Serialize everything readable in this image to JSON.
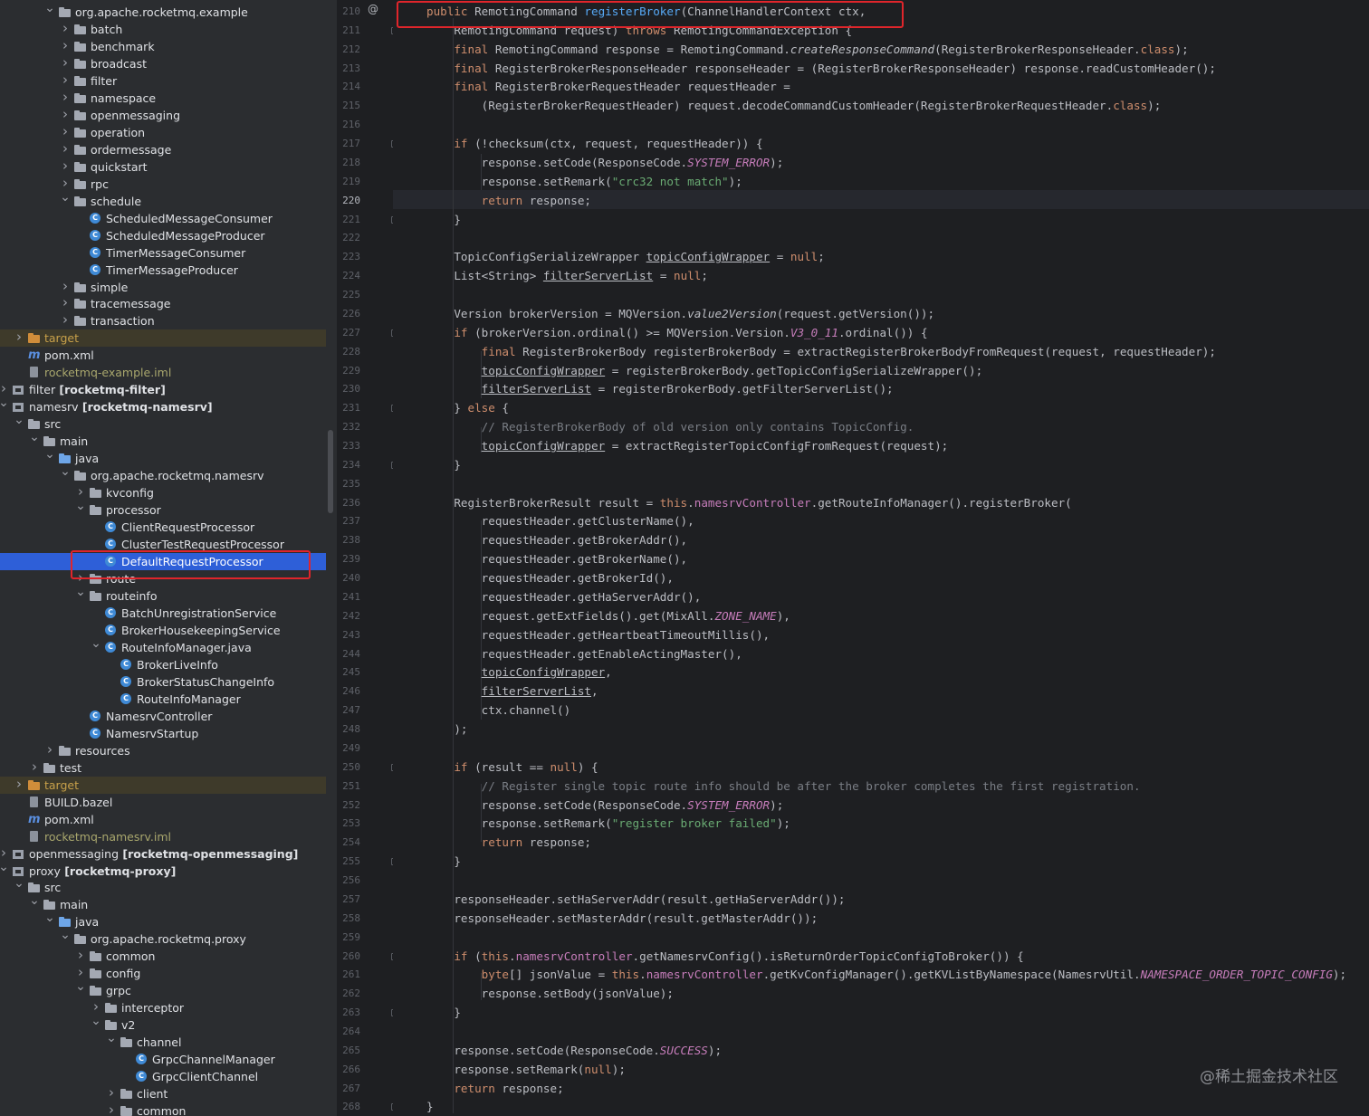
{
  "tree": {
    "rows": [
      {
        "label": "org.apache.rocketmq.example",
        "type": "package",
        "expanded": true
      },
      {
        "label": "batch",
        "type": "package"
      },
      {
        "label": "benchmark",
        "type": "package"
      },
      {
        "label": "broadcast",
        "type": "package"
      },
      {
        "label": "filter",
        "type": "package"
      },
      {
        "label": "namespace",
        "type": "package"
      },
      {
        "label": "openmessaging",
        "type": "package"
      },
      {
        "label": "operation",
        "type": "package"
      },
      {
        "label": "ordermessage",
        "type": "package"
      },
      {
        "label": "quickstart",
        "type": "package"
      },
      {
        "label": "rpc",
        "type": "package"
      },
      {
        "label": "schedule",
        "type": "package",
        "expanded": true
      },
      {
        "label": "ScheduledMessageConsumer",
        "type": "class"
      },
      {
        "label": "ScheduledMessageProducer",
        "type": "class"
      },
      {
        "label": "TimerMessageConsumer",
        "type": "class"
      },
      {
        "label": "TimerMessageProducer",
        "type": "class"
      },
      {
        "label": "simple",
        "type": "package"
      },
      {
        "label": "tracemessage",
        "type": "package"
      },
      {
        "label": "transaction",
        "type": "package"
      },
      {
        "label": "target",
        "type": "excluded"
      },
      {
        "label": "pom.xml",
        "type": "maven"
      },
      {
        "label": "rocketmq-example.iml",
        "type": "iml"
      },
      {
        "label": "filter",
        "suffix": "[rocketmq-filter]",
        "type": "module"
      },
      {
        "label": "namesrv",
        "suffix": "[rocketmq-namesrv]",
        "type": "module",
        "expanded": true
      },
      {
        "label": "src",
        "type": "folder",
        "expanded": true
      },
      {
        "label": "main",
        "type": "folder",
        "expanded": true
      },
      {
        "label": "java",
        "type": "source",
        "expanded": true
      },
      {
        "label": "org.apache.rocketmq.namesrv",
        "type": "package",
        "expanded": true
      },
      {
        "label": "kvconfig",
        "type": "package"
      },
      {
        "label": "processor",
        "type": "package",
        "expanded": true
      },
      {
        "label": "ClientRequestProcessor",
        "type": "class"
      },
      {
        "label": "ClusterTestRequestProcessor",
        "type": "class"
      },
      {
        "label": "DefaultRequestProcessor",
        "type": "class",
        "selected": true
      },
      {
        "label": "route",
        "type": "package"
      },
      {
        "label": "routeinfo",
        "type": "package",
        "expanded": true
      },
      {
        "label": "BatchUnregistrationService",
        "type": "class"
      },
      {
        "label": "BrokerHousekeepingService",
        "type": "class"
      },
      {
        "label": "RouteInfoManager.java",
        "type": "class",
        "expanded": true
      },
      {
        "label": "BrokerLiveInfo",
        "type": "class"
      },
      {
        "label": "BrokerStatusChangeInfo",
        "type": "class"
      },
      {
        "label": "RouteInfoManager",
        "type": "class"
      },
      {
        "label": "NamesrvController",
        "type": "class"
      },
      {
        "label": "NamesrvStartup",
        "type": "class"
      },
      {
        "label": "resources",
        "type": "folder"
      },
      {
        "label": "test",
        "type": "folder"
      },
      {
        "label": "target",
        "type": "excluded"
      },
      {
        "label": "BUILD.bazel",
        "type": "file"
      },
      {
        "label": "pom.xml",
        "type": "maven"
      },
      {
        "label": "rocketmq-namesrv.iml",
        "type": "iml"
      },
      {
        "label": "openmessaging",
        "suffix": "[rocketmq-openmessaging]",
        "type": "module"
      },
      {
        "label": "proxy",
        "suffix": "[rocketmq-proxy]",
        "type": "module",
        "expanded": true
      },
      {
        "label": "src",
        "type": "folder",
        "expanded": true
      },
      {
        "label": "main",
        "type": "folder",
        "expanded": true
      },
      {
        "label": "java",
        "type": "source",
        "expanded": true
      },
      {
        "label": "org.apache.rocketmq.proxy",
        "type": "package",
        "expanded": true
      },
      {
        "label": "common",
        "type": "package"
      },
      {
        "label": "config",
        "type": "package"
      },
      {
        "label": "grpc",
        "type": "package",
        "expanded": true
      },
      {
        "label": "interceptor",
        "type": "package"
      },
      {
        "label": "v2",
        "type": "package",
        "expanded": true
      },
      {
        "label": "channel",
        "type": "package",
        "expanded": true
      },
      {
        "label": "GrpcChannelManager",
        "type": "class"
      },
      {
        "label": "GrpcClientChannel",
        "type": "class"
      },
      {
        "label": "client",
        "type": "package"
      },
      {
        "label": "common",
        "type": "package"
      }
    ]
  },
  "editor": {
    "current_line": "220",
    "lines": [
      {
        "n": "210",
        "code": "public RemotingCommand registerBroker(ChannelHandlerContext ctx,"
      },
      {
        "n": "211",
        "code": "    RemotingCommand request) throws RemotingCommandException {"
      },
      {
        "n": "212",
        "code": "    final RemotingCommand response = RemotingCommand.createResponseCommand(RegisterBrokerResponseHeader.class);"
      },
      {
        "n": "213",
        "code": "    final RegisterBrokerResponseHeader responseHeader = (RegisterBrokerResponseHeader) response.readCustomHeader();"
      },
      {
        "n": "214",
        "code": "    final RegisterBrokerRequestHeader requestHeader ="
      },
      {
        "n": "215",
        "code": "        (RegisterBrokerRequestHeader) request.decodeCommandCustomHeader(RegisterBrokerRequestHeader.class);"
      },
      {
        "n": "216",
        "code": ""
      },
      {
        "n": "217",
        "code": "    if (!checksum(ctx, request, requestHeader)) {"
      },
      {
        "n": "218",
        "code": "        response.setCode(ResponseCode.SYSTEM_ERROR);"
      },
      {
        "n": "219",
        "code": "        response.setRemark(\"crc32 not match\");"
      },
      {
        "n": "220",
        "code": "        return response;"
      },
      {
        "n": "221",
        "code": "    }"
      },
      {
        "n": "222",
        "code": ""
      },
      {
        "n": "223",
        "code": "    TopicConfigSerializeWrapper topicConfigWrapper = null;"
      },
      {
        "n": "224",
        "code": "    List<String> filterServerList = null;"
      },
      {
        "n": "225",
        "code": ""
      },
      {
        "n": "226",
        "code": "    Version brokerVersion = MQVersion.value2Version(request.getVersion());"
      },
      {
        "n": "227",
        "code": "    if (brokerVersion.ordinal() >= MQVersion.Version.V3_0_11.ordinal()) {"
      },
      {
        "n": "228",
        "code": "        final RegisterBrokerBody registerBrokerBody = extractRegisterBrokerBodyFromRequest(request, requestHeader);"
      },
      {
        "n": "229",
        "code": "        topicConfigWrapper = registerBrokerBody.getTopicConfigSerializeWrapper();"
      },
      {
        "n": "230",
        "code": "        filterServerList = registerBrokerBody.getFilterServerList();"
      },
      {
        "n": "231",
        "code": "    } else {"
      },
      {
        "n": "232",
        "code": "        // RegisterBrokerBody of old version only contains TopicConfig."
      },
      {
        "n": "233",
        "code": "        topicConfigWrapper = extractRegisterTopicConfigFromRequest(request);"
      },
      {
        "n": "234",
        "code": "    }"
      },
      {
        "n": "235",
        "code": ""
      },
      {
        "n": "236",
        "code": "    RegisterBrokerResult result = this.namesrvController.getRouteInfoManager().registerBroker("
      },
      {
        "n": "237",
        "code": "        requestHeader.getClusterName(),"
      },
      {
        "n": "238",
        "code": "        requestHeader.getBrokerAddr(),"
      },
      {
        "n": "239",
        "code": "        requestHeader.getBrokerName(),"
      },
      {
        "n": "240",
        "code": "        requestHeader.getBrokerId(),"
      },
      {
        "n": "241",
        "code": "        requestHeader.getHaServerAddr(),"
      },
      {
        "n": "242",
        "code": "        request.getExtFields().get(MixAll.ZONE_NAME),"
      },
      {
        "n": "243",
        "code": "        requestHeader.getHeartbeatTimeoutMillis(),"
      },
      {
        "n": "244",
        "code": "        requestHeader.getEnableActingMaster(),"
      },
      {
        "n": "245",
        "code": "        topicConfigWrapper,"
      },
      {
        "n": "246",
        "code": "        filterServerList,"
      },
      {
        "n": "247",
        "code": "        ctx.channel()"
      },
      {
        "n": "248",
        "code": "    );"
      },
      {
        "n": "249",
        "code": ""
      },
      {
        "n": "250",
        "code": "    if (result == null) {"
      },
      {
        "n": "251",
        "code": "        // Register single topic route info should be after the broker completes the first registration."
      },
      {
        "n": "252",
        "code": "        response.setCode(ResponseCode.SYSTEM_ERROR);"
      },
      {
        "n": "253",
        "code": "        response.setRemark(\"register broker failed\");"
      },
      {
        "n": "254",
        "code": "        return response;"
      },
      {
        "n": "255",
        "code": "    }"
      },
      {
        "n": "256",
        "code": ""
      },
      {
        "n": "257",
        "code": "    responseHeader.setHaServerAddr(result.getHaServerAddr());"
      },
      {
        "n": "258",
        "code": "    responseHeader.setMasterAddr(result.getMasterAddr());"
      },
      {
        "n": "259",
        "code": ""
      },
      {
        "n": "260",
        "code": "    if (this.namesrvController.getNamesrvConfig().isReturnOrderTopicConfigToBroker()) {"
      },
      {
        "n": "261",
        "code": "        byte[] jsonValue = this.namesrvController.getKvConfigManager().getKVListByNamespace(NamesrvUtil.NAMESPACE_ORDER_TOPIC_CONFIG);"
      },
      {
        "n": "262",
        "code": "        response.setBody(jsonValue);"
      },
      {
        "n": "263",
        "code": "    }"
      },
      {
        "n": "264",
        "code": ""
      },
      {
        "n": "265",
        "code": "    response.setCode(ResponseCode.SUCCESS);"
      },
      {
        "n": "266",
        "code": "    response.setRemark(null);"
      },
      {
        "n": "267",
        "code": "    return response;"
      },
      {
        "n": "268",
        "code": "}"
      }
    ]
  },
  "watermark": "@稀土掘金技术社区",
  "colors": {
    "tree_bg": "#2b2d30",
    "editor_bg": "#1e1f22",
    "selection": "#2e5fd8",
    "highlight_box": "#e0252b",
    "keyword": "#cf8e6d",
    "string": "#6aab73",
    "field": "#c77dbb",
    "comment": "#7a7e85"
  }
}
